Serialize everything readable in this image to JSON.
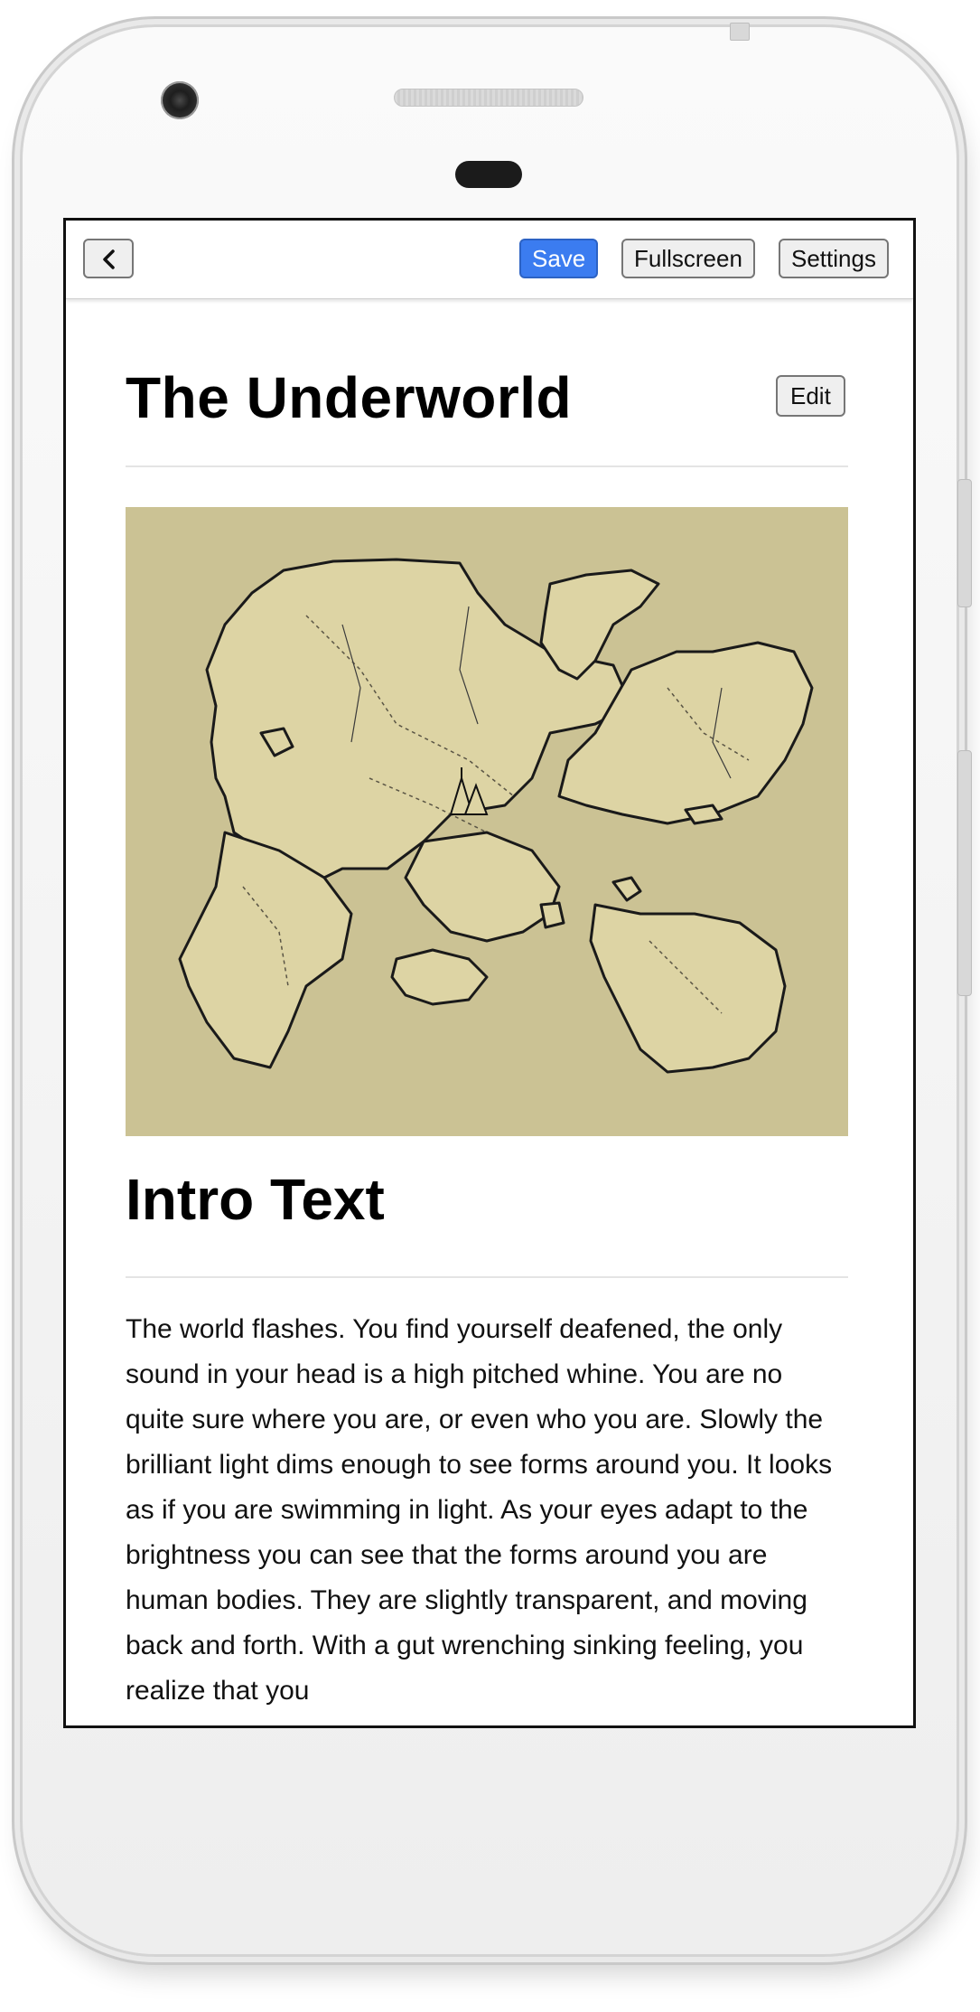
{
  "toolbar": {
    "save_label": "Save",
    "fullscreen_label": "Fullscreen",
    "settings_label": "Settings"
  },
  "page": {
    "title": "The Underworld",
    "edit_label": "Edit"
  },
  "section": {
    "title": "Intro Text",
    "text": "The world flashes. You find yourself deafened, the only sound in your head is a high pitched whine. You are no quite sure where you are, or even who you are. Slowly the brilliant light dims enough to see forms around you. It looks as if you are swimming in light. As your eyes adapt to the brightness you can see that the forms around you are human bodies. They are slightly transparent, and moving back and forth. With a gut wrenching sinking feeling, you realize that you"
  },
  "colors": {
    "save_accent": "#3b7cf0",
    "map_background": "#cbc294",
    "land": "#ddd4a4"
  },
  "icons": {
    "back": "chevron-left-icon"
  }
}
